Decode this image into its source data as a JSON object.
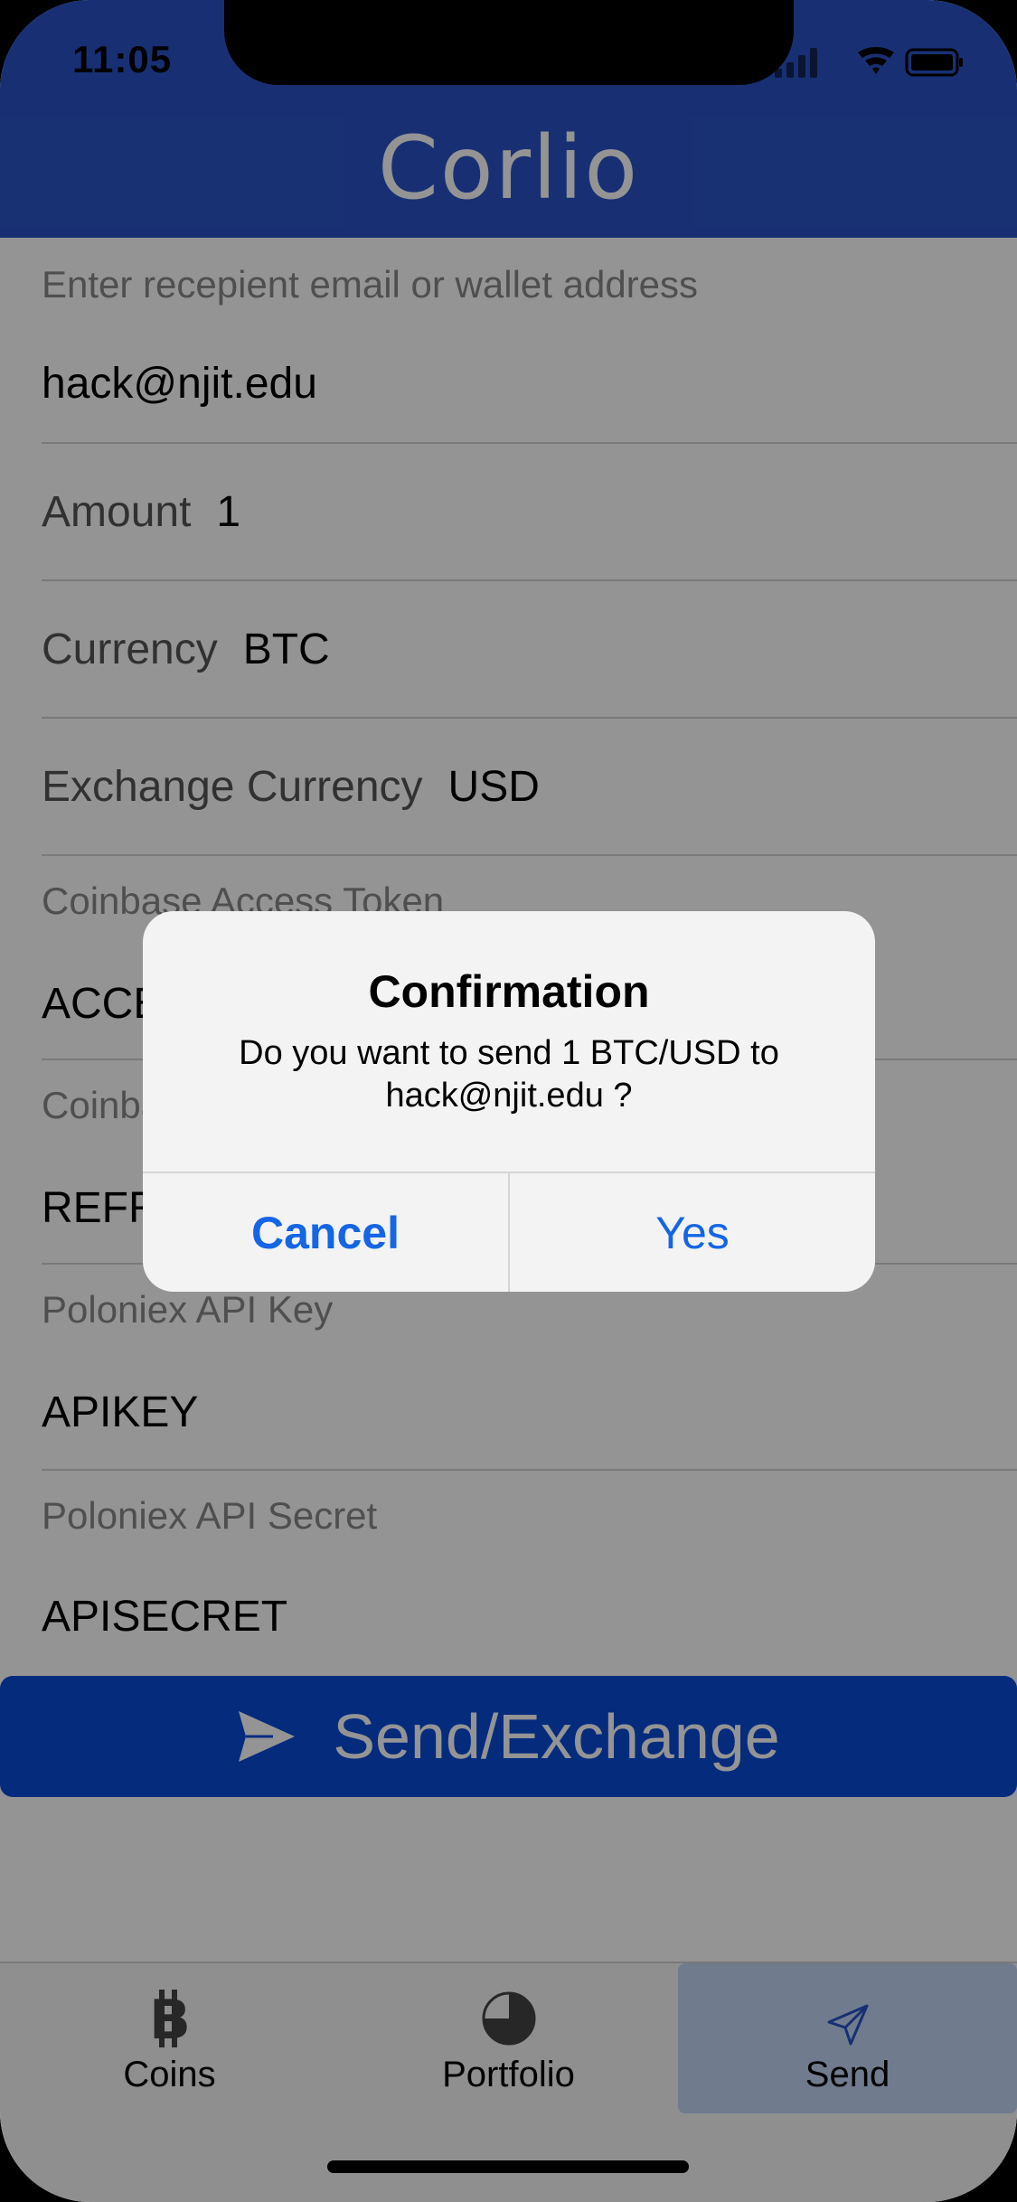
{
  "status_bar": {
    "time": "11:05"
  },
  "app": {
    "title": "Corlio"
  },
  "form": {
    "recipient_label": "Enter recepient email or wallet address",
    "recipient_value": "hack@njit.edu",
    "amount_label": "Amount",
    "amount_value": "1",
    "currency_label": "Currency",
    "currency_value": "BTC",
    "exchange_label": "Exchange Currency",
    "exchange_value": "USD",
    "coinbase_token_label": "Coinbase Access Token",
    "coinbase_token_value": "ACCESSTOKEN",
    "coinbase_refresh_label": "Coinbase Refresh Token",
    "coinbase_refresh_value": "REFRESHTOKEN",
    "poloniex_key_label": "Poloniex API Key",
    "poloniex_key_value": "APIKEY",
    "poloniex_secret_label": "Poloniex API Secret",
    "poloniex_secret_value": "APISECRET"
  },
  "send_button": {
    "label": "Send/Exchange",
    "icon": "paper-plane-icon"
  },
  "tabbar": {
    "tabs": [
      {
        "label": "Coins",
        "icon": "bitcoin-icon"
      },
      {
        "label": "Portfolio",
        "icon": "pie-chart-icon"
      },
      {
        "label": "Send",
        "icon": "send-icon",
        "active": true
      }
    ]
  },
  "alert": {
    "title": "Confirmation",
    "message": "Do you want to send 1 BTC/USD to hack@njit.edu ?",
    "cancel_label": "Cancel",
    "confirm_label": "Yes"
  },
  "colors": {
    "brand_blue": "#2a54c6",
    "button_blue": "#0a4ad8",
    "alert_action_blue": "#1565e6"
  }
}
